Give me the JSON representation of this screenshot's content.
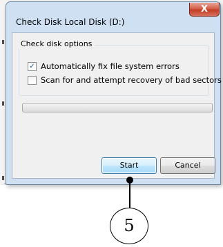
{
  "dialog": {
    "title": "Check Disk Local Disk (D:)",
    "close_glyph": "X",
    "group_label": "Check disk options",
    "options": [
      {
        "label": "Automatically fix file system errors",
        "checked": true
      },
      {
        "label": "Scan for and attempt recovery of bad sectors",
        "checked": false
      }
    ],
    "progress_fraction": 0,
    "buttons": {
      "start": "Start",
      "cancel": "Cancel"
    }
  },
  "annotation": {
    "callout_number": "5"
  },
  "colors": {
    "title_bar": "#cfe0f3",
    "close_button": "#c33c25",
    "default_button": "#bee6fd"
  }
}
